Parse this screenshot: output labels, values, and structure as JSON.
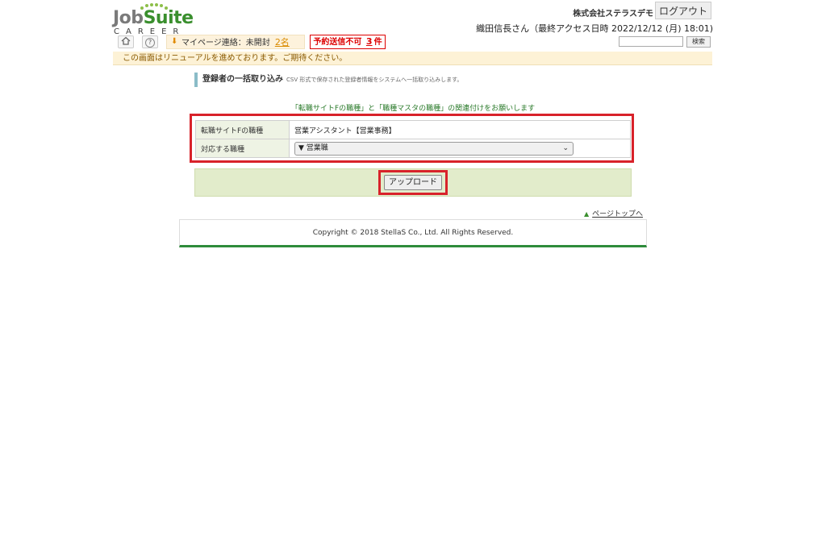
{
  "header": {
    "logo": {
      "word_job": "Job",
      "word_suite": "Suite",
      "sub": "CAREER"
    },
    "company_name": "株式会社ステラスデモ",
    "logout_label": "ログアウト",
    "user_line": "織田信長さん（最終アクセス日時 2022/12/12 (月) 18:01)",
    "home_icon": "home-icon",
    "help_icon": "help-icon",
    "mypage": {
      "label": "マイページ連絡：未開封",
      "count": "2名"
    },
    "alert": {
      "prefix": "予約送信不可",
      "count": "3",
      "suffix": "件"
    },
    "search": {
      "value": "",
      "button_label": "検索"
    }
  },
  "notice": "この画面はリニューアルを進めております。ご期待ください。",
  "page": {
    "title": "登録者の一括取り込み",
    "description": "CSV 形式で保存された登録者情報をシステムへ一括取り込みします。",
    "instruction": "「転職サイトFの職種」と「職種マスタの職種」の関連付けをお願いします"
  },
  "form": {
    "rows": [
      {
        "label": "転職サイトFの職種",
        "value": "営業アシスタント【営業事務】"
      },
      {
        "label": "対応する職種",
        "select_value": "▼ 営業職"
      }
    ],
    "upload_label": "アップロード"
  },
  "pagetop_label": "ページトップへ",
  "footer": "Copyright © 2018 StellaS Co., Ltd. All Rights Reserved.",
  "colors": {
    "brand_green": "#3a8f2e",
    "highlight_red": "#d8222a",
    "notice_bg": "#fdf2d6"
  }
}
